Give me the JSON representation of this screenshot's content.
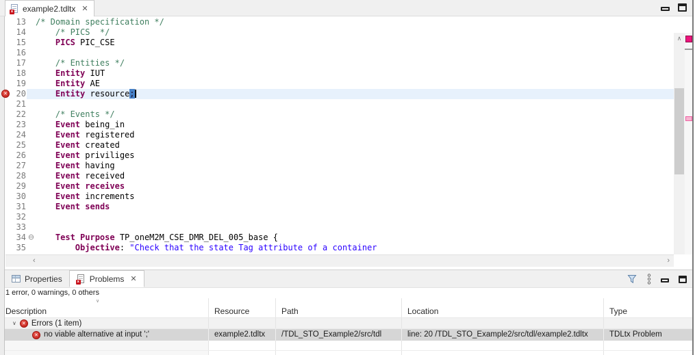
{
  "colors": {
    "keyword": "#7f0055",
    "comment": "#3f7f5f",
    "string": "#2a00ff",
    "error_red": "#c9151e",
    "current_line_bg": "#e7f1fc",
    "selection_bg": "#4782c8",
    "overview_error_marker": "#ed147d",
    "selected_row_bg": "#d6d6d6"
  },
  "editor": {
    "tab": {
      "label": "example2.tdltx",
      "close_glyph": "✕"
    },
    "fold_collapse_glyph": "⊖",
    "gutter_error_glyph": "✕",
    "scrollbar": {
      "up_glyph": "∧",
      "down_glyph": "∨",
      "left_glyph": "‹",
      "right_glyph": "›"
    },
    "lines": [
      {
        "num": "13",
        "segments": [
          {
            "t": "/* Domain specification */",
            "c": "comment"
          }
        ]
      },
      {
        "num": "14",
        "segments": [
          {
            "t": "    /* PICS  */",
            "c": "comment"
          }
        ]
      },
      {
        "num": "15",
        "segments": [
          {
            "t": "    ",
            "c": "plain"
          },
          {
            "t": "PICS",
            "c": "keyword"
          },
          {
            "t": " PIC_CSE",
            "c": "plain"
          }
        ]
      },
      {
        "num": "16",
        "segments": []
      },
      {
        "num": "17",
        "segments": [
          {
            "t": "    ",
            "c": "plain"
          },
          {
            "t": "/* Entities */",
            "c": "comment"
          }
        ]
      },
      {
        "num": "18",
        "segments": [
          {
            "t": "    ",
            "c": "plain"
          },
          {
            "t": "Entity",
            "c": "keyword"
          },
          {
            "t": " IUT",
            "c": "plain"
          }
        ]
      },
      {
        "num": "19",
        "segments": [
          {
            "t": "    ",
            "c": "plain"
          },
          {
            "t": "Entity",
            "c": "keyword"
          },
          {
            "t": " AE",
            "c": "plain"
          }
        ]
      },
      {
        "num": "20",
        "error": true,
        "current": true,
        "cursor": true,
        "segments": [
          {
            "t": "    ",
            "c": "plain"
          },
          {
            "t": "Entity",
            "c": "keyword"
          },
          {
            "t": " resource",
            "c": "plain"
          },
          {
            "t": ";",
            "c": "selected"
          }
        ]
      },
      {
        "num": "21",
        "segments": []
      },
      {
        "num": "22",
        "segments": [
          {
            "t": "    ",
            "c": "plain"
          },
          {
            "t": "/* Events */",
            "c": "comment"
          }
        ]
      },
      {
        "num": "23",
        "segments": [
          {
            "t": "    ",
            "c": "plain"
          },
          {
            "t": "Event",
            "c": "keyword"
          },
          {
            "t": " being_in",
            "c": "plain"
          }
        ]
      },
      {
        "num": "24",
        "segments": [
          {
            "t": "    ",
            "c": "plain"
          },
          {
            "t": "Event",
            "c": "keyword"
          },
          {
            "t": " registered",
            "c": "plain"
          }
        ]
      },
      {
        "num": "25",
        "segments": [
          {
            "t": "    ",
            "c": "plain"
          },
          {
            "t": "Event",
            "c": "keyword"
          },
          {
            "t": " created",
            "c": "plain"
          }
        ]
      },
      {
        "num": "26",
        "segments": [
          {
            "t": "    ",
            "c": "plain"
          },
          {
            "t": "Event",
            "c": "keyword"
          },
          {
            "t": " priviliges",
            "c": "plain"
          }
        ]
      },
      {
        "num": "27",
        "segments": [
          {
            "t": "    ",
            "c": "plain"
          },
          {
            "t": "Event",
            "c": "keyword"
          },
          {
            "t": " having",
            "c": "plain"
          }
        ]
      },
      {
        "num": "28",
        "segments": [
          {
            "t": "    ",
            "c": "plain"
          },
          {
            "t": "Event",
            "c": "keyword"
          },
          {
            "t": " received",
            "c": "plain"
          }
        ]
      },
      {
        "num": "29",
        "segments": [
          {
            "t": "    ",
            "c": "plain"
          },
          {
            "t": "Event",
            "c": "keyword"
          },
          {
            "t": " ",
            "c": "plain"
          },
          {
            "t": "receives",
            "c": "keyword"
          }
        ]
      },
      {
        "num": "30",
        "segments": [
          {
            "t": "    ",
            "c": "plain"
          },
          {
            "t": "Event",
            "c": "keyword"
          },
          {
            "t": " increments",
            "c": "plain"
          }
        ]
      },
      {
        "num": "31",
        "segments": [
          {
            "t": "    ",
            "c": "plain"
          },
          {
            "t": "Event",
            "c": "keyword"
          },
          {
            "t": " ",
            "c": "plain"
          },
          {
            "t": "sends",
            "c": "keyword"
          }
        ]
      },
      {
        "num": "32",
        "segments": []
      },
      {
        "num": "33",
        "segments": []
      },
      {
        "num": "34",
        "fold": true,
        "segments": [
          {
            "t": "    ",
            "c": "plain"
          },
          {
            "t": "Test Purpose",
            "c": "keyword"
          },
          {
            "t": " TP_oneM2M_CSE_DMR_DEL_005_base {",
            "c": "plain"
          }
        ]
      },
      {
        "num": "35",
        "segments": [
          {
            "t": "        ",
            "c": "plain"
          },
          {
            "t": "Objective",
            "c": "keyword"
          },
          {
            "t": ": ",
            "c": "plain"
          },
          {
            "t": "\"Check that the state Tag attribute of a container",
            "c": "string"
          }
        ]
      }
    ]
  },
  "problems_panel": {
    "tabs": [
      {
        "label": "Properties",
        "active": false
      },
      {
        "label": "Problems",
        "active": true
      }
    ],
    "tab_close_glyph": "✕",
    "summary": "1 error, 0 warnings, 0 others",
    "sort_glyph": "∨",
    "expander_glyph": "∨",
    "table": {
      "columns": [
        "Description",
        "Resource",
        "Path",
        "Location",
        "Type"
      ],
      "group": {
        "label": "Errors (1 item)"
      },
      "rows": [
        {
          "description": "no viable alternative at input ';'",
          "resource": "example2.tdltx",
          "path": "/TDL_STO_Example2/src/tdl",
          "location": "line: 20 /TDL_STO_Example2/src/tdl/example2.tdltx",
          "type": "TDLtx Problem",
          "selected": true
        }
      ]
    }
  }
}
